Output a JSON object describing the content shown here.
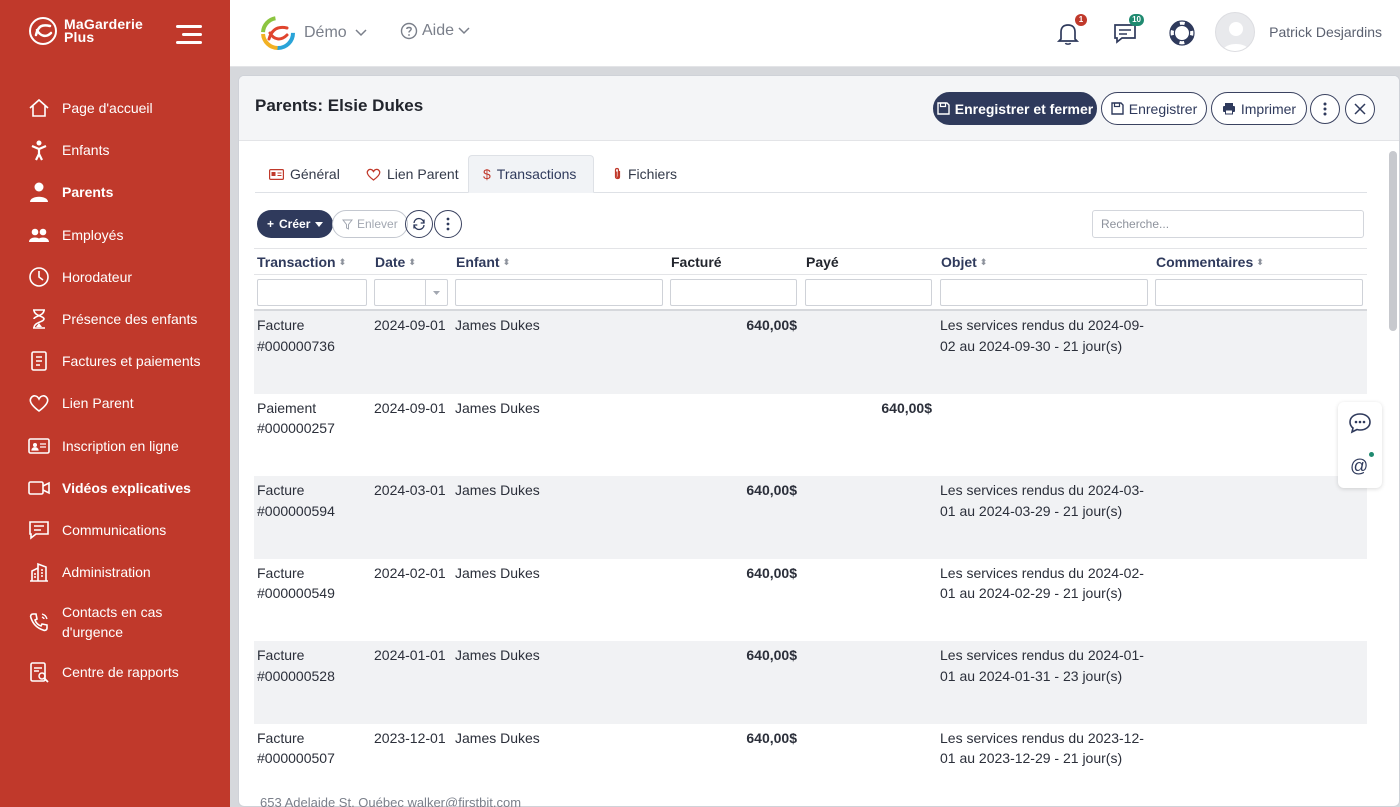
{
  "brand": {
    "line1": "MaGarderie",
    "line2": "Plus"
  },
  "sidebar": {
    "items": [
      {
        "label": "Page d'accueil",
        "icon": "home-icon"
      },
      {
        "label": "Enfants",
        "icon": "child-icon"
      },
      {
        "label": "Parents",
        "icon": "parent-icon",
        "active": true
      },
      {
        "label": "Employés",
        "icon": "employees-icon"
      },
      {
        "label": "Horodateur",
        "icon": "clock-icon"
      },
      {
        "label": "Présence des enfants",
        "icon": "hourglass-icon"
      },
      {
        "label": "Factures et paiements",
        "icon": "invoice-icon"
      },
      {
        "label": "Lien Parent",
        "icon": "heart-icon"
      },
      {
        "label": "Inscription en ligne",
        "icon": "id-card-icon"
      },
      {
        "label": "Vidéos explicatives",
        "icon": "video-icon"
      },
      {
        "label": "Communications",
        "icon": "message-icon"
      },
      {
        "label": "Administration",
        "icon": "building-icon"
      },
      {
        "label": "Contacts en cas d'urgence",
        "icon": "phone-icon"
      },
      {
        "label": "Centre de rapports",
        "icon": "report-icon"
      }
    ]
  },
  "topbar": {
    "demo_label": "Démo",
    "aide_label": "Aide",
    "notif_count": "1",
    "messages_count": "10",
    "user_name": "Patrick Desjardins"
  },
  "panel": {
    "title": "Parents: Elsie Dukes",
    "buttons": {
      "save_close": "Enregistrer et fermer",
      "save": "Enregistrer",
      "print": "Imprimer"
    },
    "tabs": [
      {
        "label": "Général",
        "icon": "id-card-icon"
      },
      {
        "label": "Lien Parent",
        "icon": "heart-icon"
      },
      {
        "label": "Transactions",
        "icon": "dollar-icon",
        "active": true
      },
      {
        "label": "Fichiers",
        "icon": "paperclip-icon"
      }
    ]
  },
  "toolbar": {
    "create_label": "Créer",
    "remove_label": "Enlever",
    "search_placeholder": "Recherche..."
  },
  "table": {
    "columns": [
      "Transaction",
      "Date",
      "Enfant",
      "Facturé",
      "Payé",
      "Objet",
      "Commentaires"
    ],
    "rows": [
      {
        "transaction": "Facture #000000736",
        "date": "2024-09-01",
        "enfant": "James Dukes",
        "facture": "640,00$",
        "paye": "",
        "objet": "Les services rendus du 2024-09-02 au 2024-09-30 - 21 jour(s)",
        "commentaires": ""
      },
      {
        "transaction": "Paiement #000000257",
        "date": "2024-09-01",
        "enfant": "James Dukes",
        "facture": "",
        "paye": "640,00$",
        "objet": "",
        "commentaires": ""
      },
      {
        "transaction": "Facture #000000594",
        "date": "2024-03-01",
        "enfant": "James Dukes",
        "facture": "640,00$",
        "paye": "",
        "objet": "Les services rendus du 2024-03-01 au 2024-03-29 - 21 jour(s)",
        "commentaires": ""
      },
      {
        "transaction": "Facture #000000549",
        "date": "2024-02-01",
        "enfant": "James Dukes",
        "facture": "640,00$",
        "paye": "",
        "objet": "Les services rendus du 2024-02-01 au 2024-02-29 - 21 jour(s)",
        "commentaires": ""
      },
      {
        "transaction": "Facture #000000528",
        "date": "2024-01-01",
        "enfant": "James Dukes",
        "facture": "640,00$",
        "paye": "",
        "objet": "Les services rendus du 2024-01-01 au 2024-01-31 - 23 jour(s)",
        "commentaires": ""
      },
      {
        "transaction": "Facture #000000507",
        "date": "2023-12-01",
        "enfant": "James Dukes",
        "facture": "640,00$",
        "paye": "",
        "objet": "Les services rendus du 2023-12-01 au 2023-12-29 - 21 jour(s)",
        "commentaires": ""
      }
    ]
  },
  "footer": {
    "text": "653 Adelaide St, Québec   walker@firstbit.com"
  },
  "colors": {
    "sidebar": "#c0392b",
    "primary": "#2f3a5c",
    "badge_red": "#c0392b",
    "badge_teal": "#1f8a70"
  }
}
